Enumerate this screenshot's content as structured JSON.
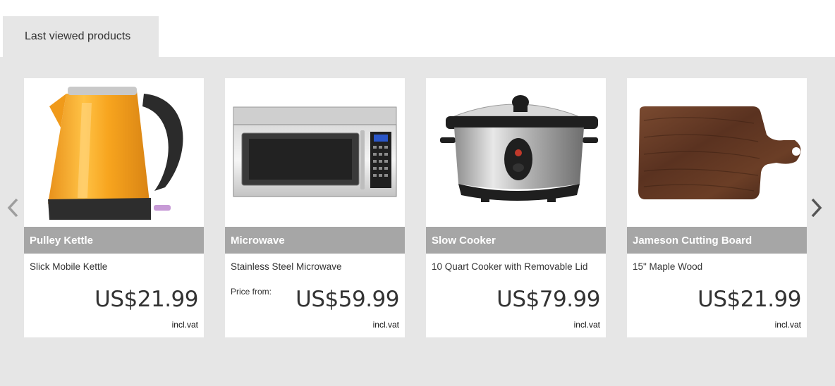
{
  "tab": {
    "label": "Last viewed products"
  },
  "carousel": {
    "prev_icon": "chevron-left-icon",
    "next_icon": "chevron-right-icon"
  },
  "products": [
    {
      "name": "Pulley Kettle",
      "description": "Slick Mobile Kettle",
      "price_from": "",
      "price": "US$21.99",
      "vat": "incl.vat",
      "image": "kettle-image"
    },
    {
      "name": "Microwave",
      "description": "Stainless Steel Microwave",
      "price_from": "Price from:",
      "price": "US$59.99",
      "vat": "incl.vat",
      "image": "microwave-image"
    },
    {
      "name": "Slow Cooker",
      "description": "10 Quart Cooker with Removable Lid",
      "price_from": "",
      "price": "US$79.99",
      "vat": "incl.vat",
      "image": "slow-cooker-image"
    },
    {
      "name": "Jameson Cutting Board",
      "description": "15\" Maple Wood",
      "price_from": "",
      "price": "US$21.99",
      "vat": "incl.vat",
      "image": "cutting-board-image"
    }
  ],
  "colors": {
    "panel_background": "#e6e6e6",
    "name_bar": "#a6a6a6",
    "kettle_orange": "#f5a21c"
  }
}
